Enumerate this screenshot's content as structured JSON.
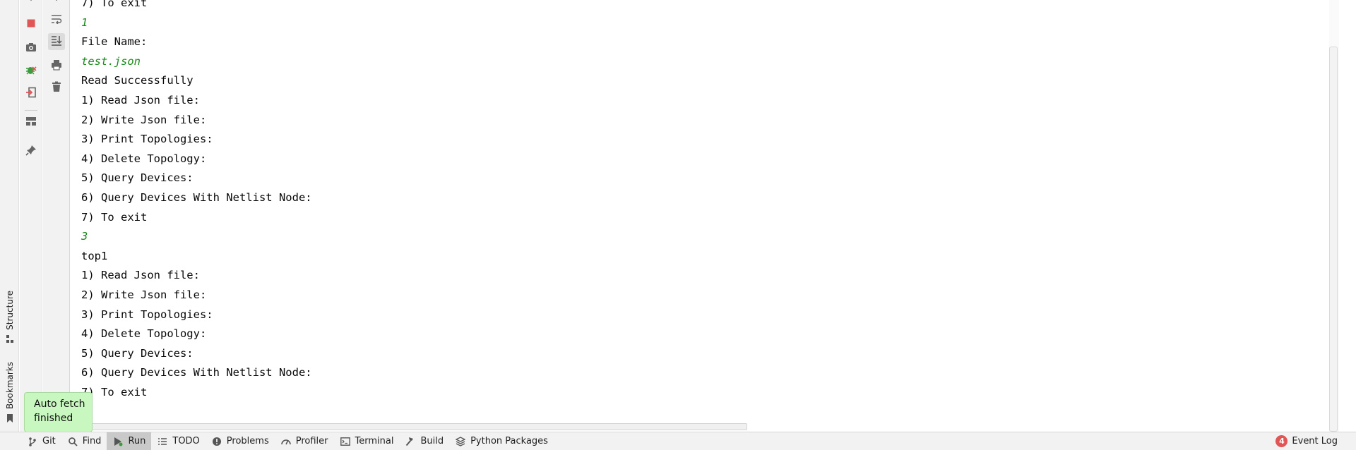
{
  "console": {
    "lines": [
      {
        "text": "7) To exit",
        "kind": "output"
      },
      {
        "text": "1",
        "kind": "input"
      },
      {
        "text": "File Name:",
        "kind": "output"
      },
      {
        "text": "test.json",
        "kind": "input"
      },
      {
        "text": "Read Successfully",
        "kind": "output"
      },
      {
        "text": "1) Read Json file:",
        "kind": "output"
      },
      {
        "text": "2) Write Json file:",
        "kind": "output"
      },
      {
        "text": "3) Print Topologies:",
        "kind": "output"
      },
      {
        "text": "4) Delete Topology:",
        "kind": "output"
      },
      {
        "text": "5) Query Devices:",
        "kind": "output"
      },
      {
        "text": "6) Query Devices With Netlist Node:",
        "kind": "output"
      },
      {
        "text": "7) To exit",
        "kind": "output"
      },
      {
        "text": "3",
        "kind": "input"
      },
      {
        "text": "top1",
        "kind": "output"
      },
      {
        "text": "1) Read Json file:",
        "kind": "output"
      },
      {
        "text": "2) Write Json file:",
        "kind": "output"
      },
      {
        "text": "3) Print Topologies:",
        "kind": "output"
      },
      {
        "text": "4) Delete Topology:",
        "kind": "output"
      },
      {
        "text": "5) Query Devices:",
        "kind": "output"
      },
      {
        "text": "6) Query Devices With Netlist Node:",
        "kind": "output"
      },
      {
        "text": "7) To exit",
        "kind": "output"
      }
    ]
  },
  "left_strip": {
    "structure_label": "Structure",
    "bookmarks_label": "Bookmarks"
  },
  "run_toolbar": {
    "buttons": [
      "stop-icon",
      "camera-icon",
      "debug-bug-icon",
      "exit-import-icon",
      "layout-icon",
      "pin-icon"
    ]
  },
  "console_toolbar": {
    "buttons": [
      "soft-wrap-icon",
      "scroll-to-end-icon",
      "print-icon",
      "trash-icon"
    ]
  },
  "tooltip": {
    "line1": "Auto fetch",
    "line2": "finished"
  },
  "bottom_bar": {
    "items": [
      {
        "label": "Git",
        "icon": "git-branch-icon",
        "active": false
      },
      {
        "label": "Find",
        "icon": "search-icon",
        "active": false
      },
      {
        "label": "Run",
        "icon": "run-icon",
        "active": true
      },
      {
        "label": "TODO",
        "icon": "list-icon",
        "active": false
      },
      {
        "label": "Problems",
        "icon": "problems-icon",
        "active": false
      },
      {
        "label": "Profiler",
        "icon": "profiler-icon",
        "active": false
      },
      {
        "label": "Terminal",
        "icon": "terminal-icon",
        "active": false
      },
      {
        "label": "Build",
        "icon": "hammer-icon",
        "active": false
      },
      {
        "label": "Python Packages",
        "icon": "packages-icon",
        "active": false
      }
    ],
    "event_log": {
      "label": "Event Log",
      "count": "4"
    }
  },
  "colors": {
    "input_text": "#1d8a1d",
    "stop_red": "#e05555",
    "tooltip_bg": "#c8f7c0",
    "badge_red": "#e05555"
  }
}
